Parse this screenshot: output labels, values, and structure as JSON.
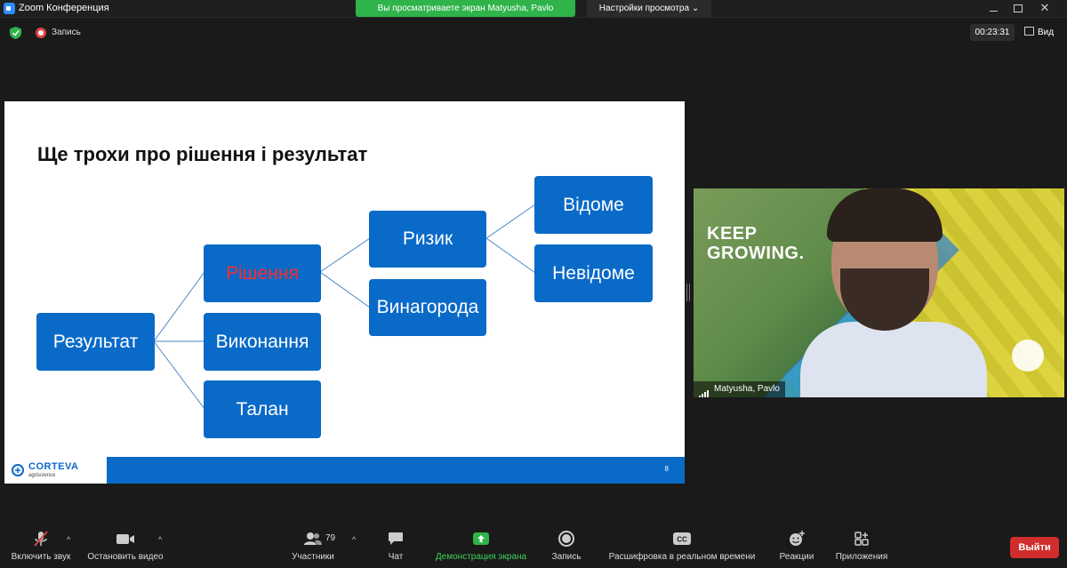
{
  "window": {
    "title": "Zoom Конференция",
    "close_glyph": "✕"
  },
  "share_banner": "Вы просматриваете экран Matyusha, Pavlo",
  "view_options": "Настройки просмотра ⌄",
  "recording": {
    "label": "Запись",
    "timer": "00:23:31"
  },
  "view_button": "Вид",
  "slide": {
    "title": "Ще трохи про рішення і результат",
    "nodes": {
      "result": "Результат",
      "decision": "Рішення",
      "execution": "Виконання",
      "luck": "Талан",
      "risk": "Ризик",
      "reward": "Винагорода",
      "known": "Відоме",
      "unknown": "Невідоме"
    },
    "logo": {
      "name": "CORTEVA",
      "sub": "agriscience"
    },
    "page_number": "8"
  },
  "video": {
    "participant_name": "Matyusha, Pavlo",
    "background_text_1": "KEEP",
    "background_text_2": "GROWING."
  },
  "toolbar": {
    "mute": "Включить звук",
    "video": "Остановить видео",
    "participants": "Участники",
    "participants_count": "79",
    "chat": "Чат",
    "share": "Демонстрация экрана",
    "record": "Запись",
    "transcript": "Расшифровка в реальном времени",
    "reactions": "Реакции",
    "apps": "Приложения",
    "leave": "Выйти",
    "caret": "^"
  },
  "colors": {
    "accent": "#0a6ac8",
    "share_green": "#2fb34a",
    "leave_red": "#d22d2d"
  }
}
